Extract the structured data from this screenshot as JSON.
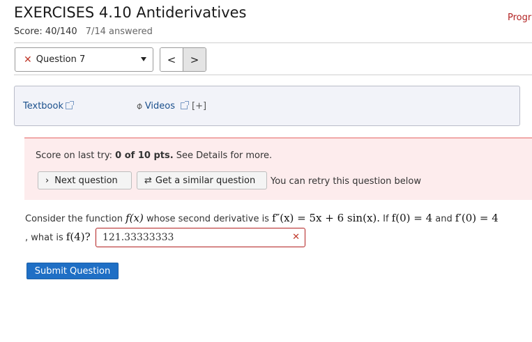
{
  "header": {
    "title": "EXERCISES 4.10 Antiderivatives",
    "progress_link": "Progr",
    "score": "Score: 40/140",
    "answered": "7/14 answered"
  },
  "question_nav": {
    "selected_question": "Question 7",
    "status_icon": "x-mark-icon",
    "prev_label": "<",
    "next_label": ">"
  },
  "help": {
    "textbook_label": "Textbook",
    "videos_label": "Videos",
    "more_label": "[+]"
  },
  "result": {
    "prefix": "Score on last try: ",
    "score": "0 of 10 pts.",
    "suffix": " See Details for more.",
    "next_question_label": "Next question",
    "similar_question_label": "Get a similar question",
    "retry_text": "You can retry this question below"
  },
  "problem": {
    "text1": "Consider the function ",
    "f_x": "f(x)",
    "text2": " whose second derivative is ",
    "second_derivative": "f″(x) = 5x + 6 sin(x).",
    "text3": " If ",
    "condition1": "f(0) = 4",
    "text4": " and ",
    "condition2": "f′(0) = 4",
    "text5": ", what is ",
    "ask": "f(4)?",
    "answer_value": "121.33333333",
    "answer_status": "incorrect"
  },
  "submit_label": "Submit Question",
  "colors": {
    "link": "#1a4f8c",
    "error": "#b21f1f",
    "primary_button": "#1f6fc5",
    "result_bg": "#fdeced"
  }
}
